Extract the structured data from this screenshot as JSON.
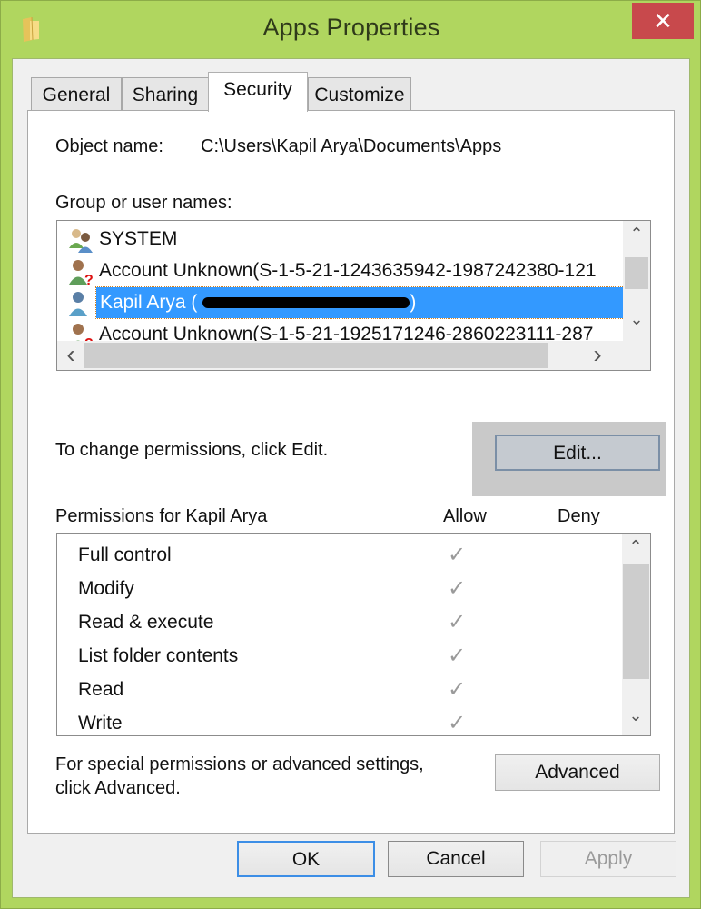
{
  "window": {
    "title": "Apps Properties",
    "close_label": "✕",
    "accent_color": "#b0d65f",
    "close_color": "#c8494c"
  },
  "tabs": [
    {
      "label": "General",
      "active": false
    },
    {
      "label": "Sharing",
      "active": false
    },
    {
      "label": "Security",
      "active": true
    },
    {
      "label": "Customize",
      "active": false
    }
  ],
  "security": {
    "object_name_label": "Object name:",
    "object_name_value": "C:\\Users\\Kapil Arya\\Documents\\Apps",
    "group_label": "Group or user names:",
    "users": [
      {
        "name": "SYSTEM",
        "icon": "group-users-icon",
        "selected": false
      },
      {
        "name": "Account Unknown(S-1-5-21-1243635942-1987242380-121",
        "icon": "unknown-user-icon",
        "selected": false
      },
      {
        "name": "Kapil Arya (",
        "suffix": ")",
        "redacted": true,
        "icon": "user-icon",
        "selected": true
      },
      {
        "name": "Account Unknown(S-1-5-21-1925171246-2860223111-287",
        "icon": "unknown-user-icon",
        "selected": false
      }
    ],
    "change_hint": "To change permissions, click Edit.",
    "edit_label": "Edit...",
    "permissions_label": "Permissions for Kapil Arya",
    "allow_header": "Allow",
    "deny_header": "Deny",
    "permissions": [
      {
        "name": "Full control",
        "allow": true,
        "deny": false
      },
      {
        "name": "Modify",
        "allow": true,
        "deny": false
      },
      {
        "name": "Read & execute",
        "allow": true,
        "deny": false
      },
      {
        "name": "List folder contents",
        "allow": true,
        "deny": false
      },
      {
        "name": "Read",
        "allow": true,
        "deny": false
      },
      {
        "name": "Write",
        "allow": true,
        "deny": false
      }
    ],
    "advanced_hint_1": "For special permissions or advanced settings,",
    "advanced_hint_2": "click Advanced.",
    "advanced_label": "Advanced"
  },
  "footer": {
    "ok_label": "OK",
    "cancel_label": "Cancel",
    "apply_label": "Apply",
    "apply_enabled": false
  },
  "glyphs": {
    "check": "✓",
    "up": "⌃",
    "down": "⌄",
    "left": "‹",
    "right": "›"
  }
}
